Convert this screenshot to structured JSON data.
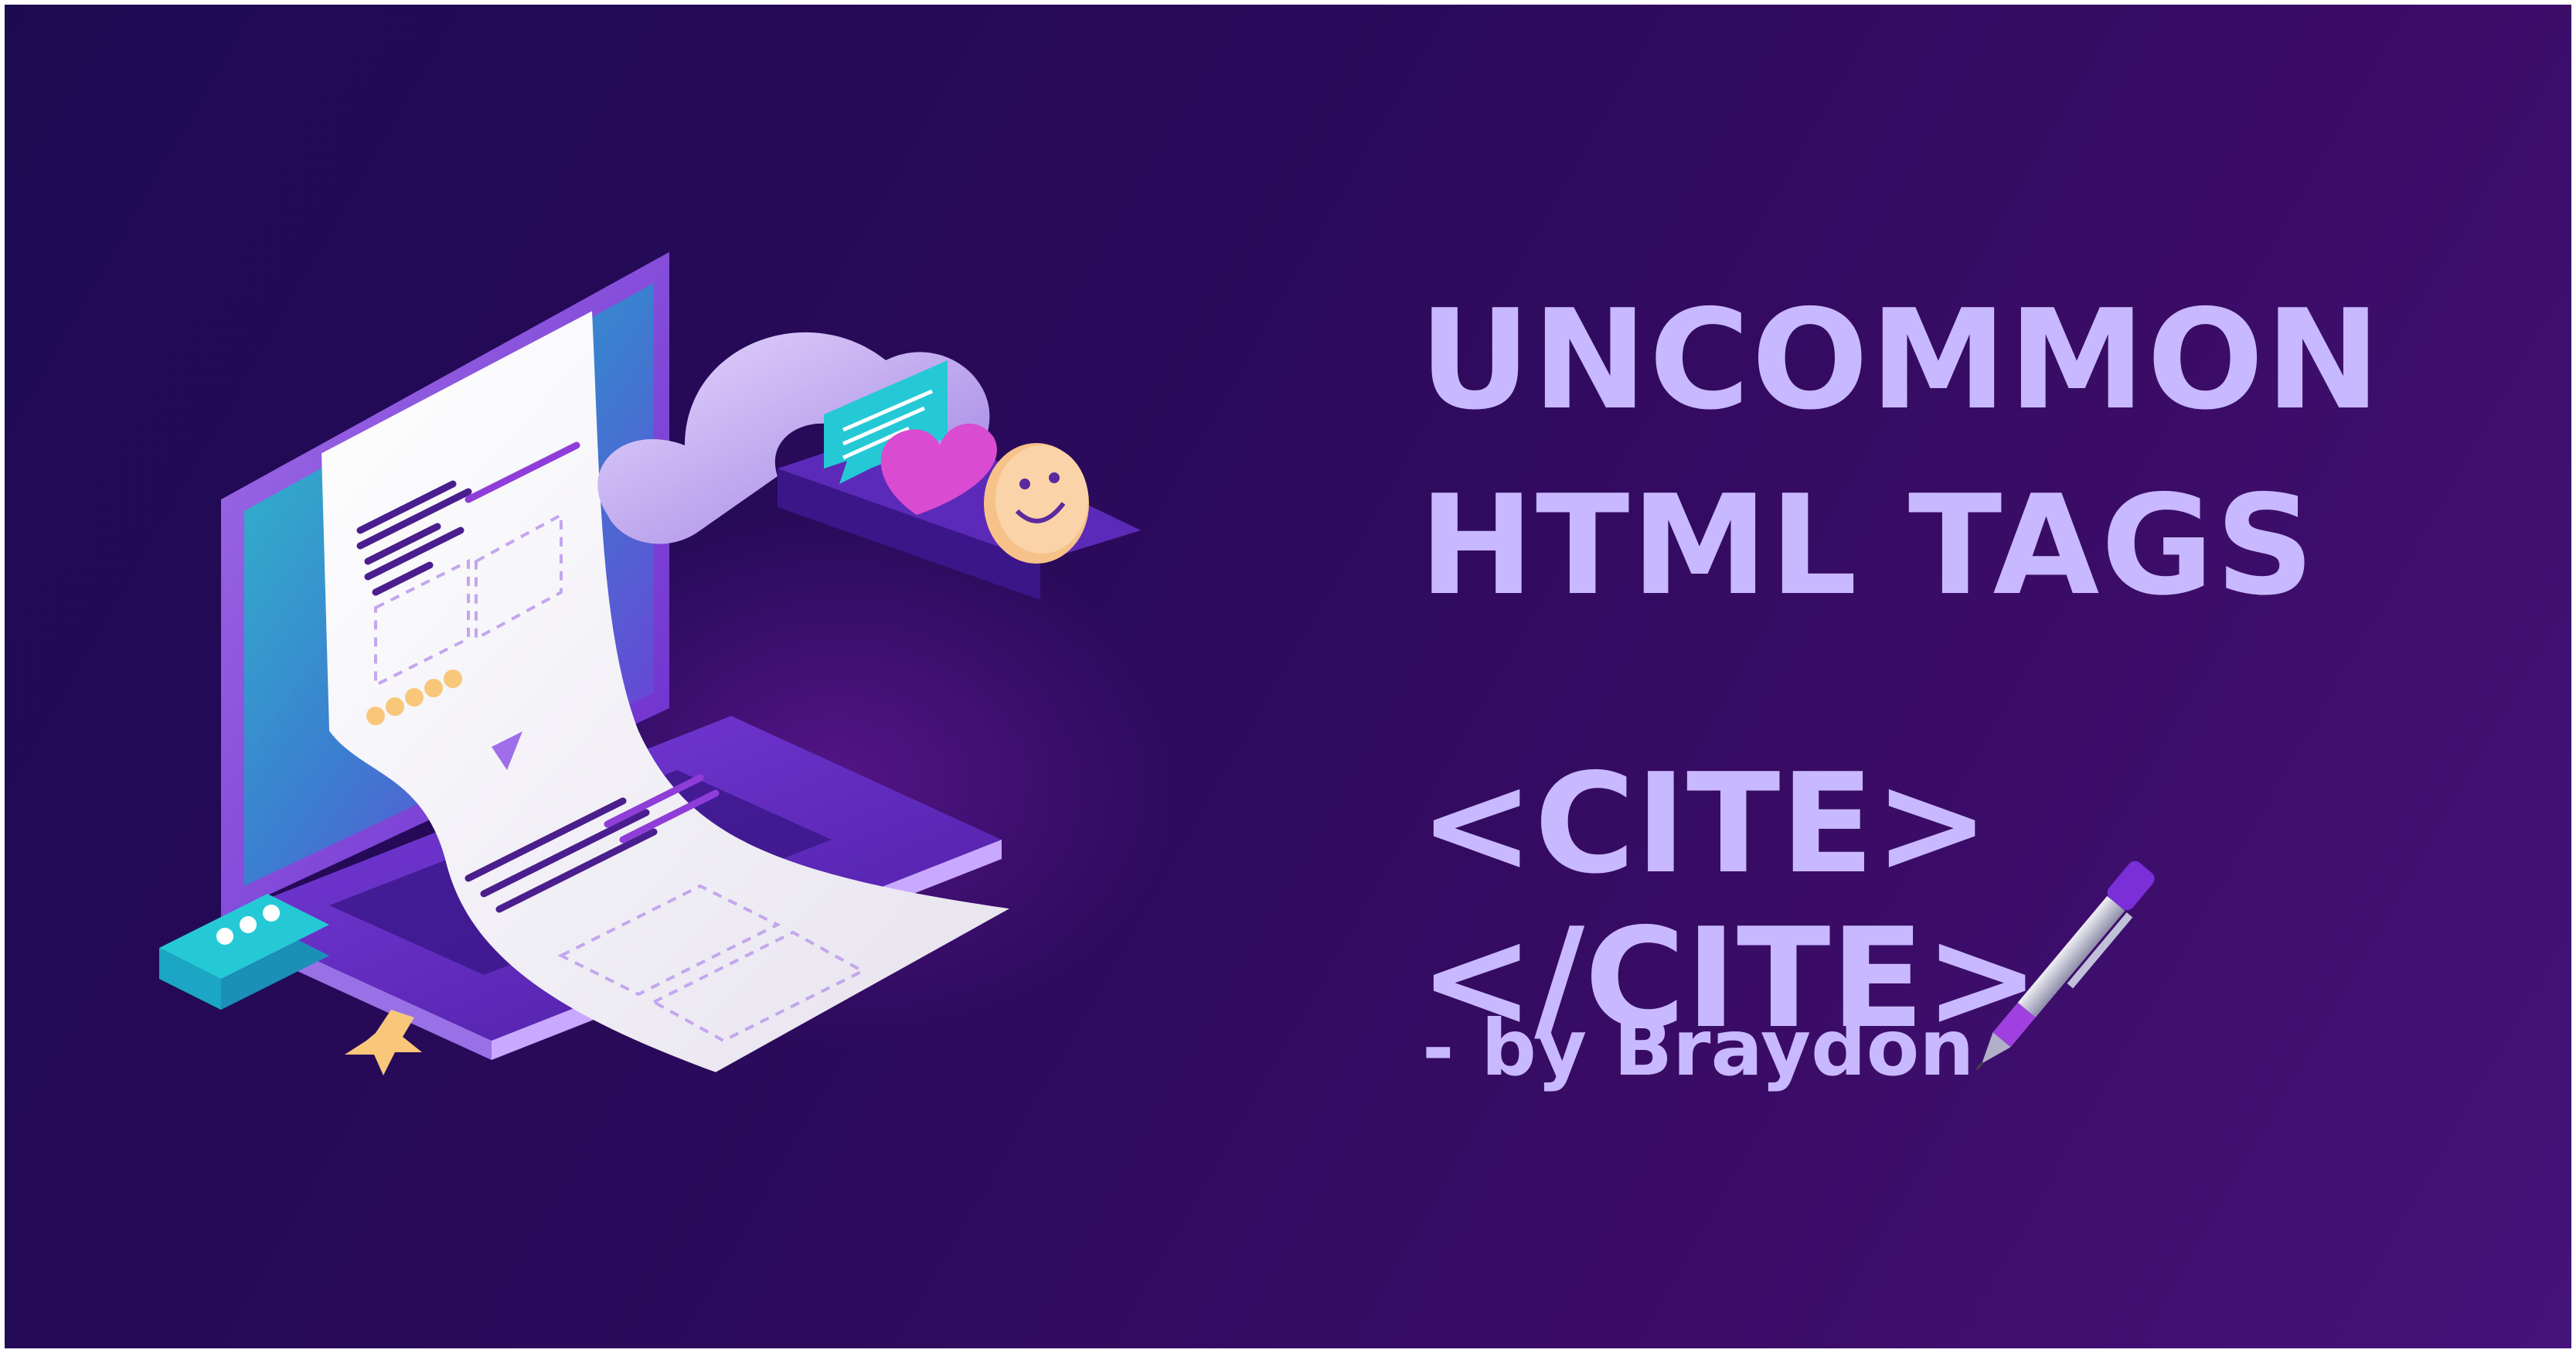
{
  "headline": {
    "line1": "UNCOMMON",
    "line2": "HTML TAGS"
  },
  "tag": "<CITE></CITE>",
  "byline": "- by Braydon",
  "colors": {
    "background_start": "#1d0b52",
    "background_end": "#44137a",
    "text": "#c8b8ff",
    "accent_teal": "#25c9d6",
    "accent_pink": "#d94bd1",
    "accent_peach": "#f7c28a"
  },
  "icons": [
    "laptop-icon",
    "document-icon",
    "cloud-icon",
    "chat-bubble-icon",
    "heart-icon",
    "smiley-icon",
    "star-icon",
    "pen-icon"
  ]
}
